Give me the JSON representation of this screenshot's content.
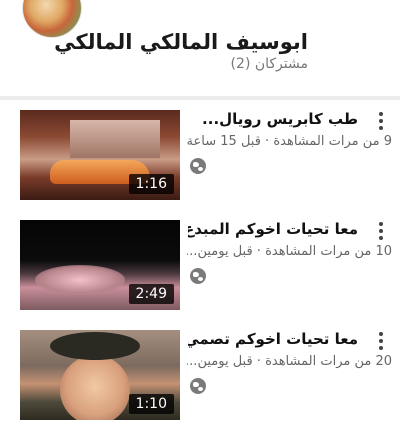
{
  "channel": {
    "name": "ابوسيف المالكي المالكي",
    "subscribers": "مشتركان (2)"
  },
  "videos": [
    {
      "title": "طب كابريس رويال...",
      "meta": "9 من مرات المشاهدة · قبل 15 ساعة",
      "duration": "1:16",
      "visibility_icon": "globe-icon"
    },
    {
      "title": "معا تحيات اخوكم المبدع...",
      "meta": "10 من مرات المشاهدة · قبل يومين...",
      "duration": "2:49",
      "visibility_icon": "globe-icon"
    },
    {
      "title": "معا تحيات اخوكم تصمي...",
      "meta": "20 من مرات المشاهدة · قبل يومين...",
      "duration": "1:10",
      "visibility_icon": "globe-icon"
    }
  ]
}
